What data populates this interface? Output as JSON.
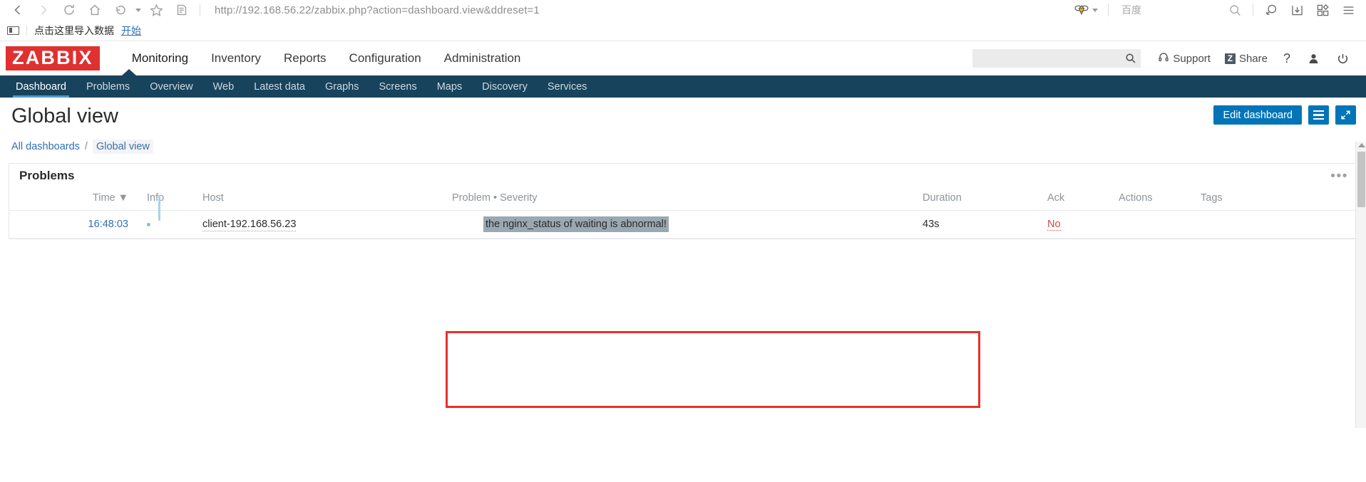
{
  "browser": {
    "url": "http://192.168.56.22/zabbix.php?action=dashboard.view&ddreset=1",
    "search_engine": "百度",
    "search_placeholder": "",
    "nav_icons": [
      "back-icon",
      "forward-icon",
      "reload-icon",
      "home-icon",
      "history-back-icon",
      "bookmark-star-icon",
      "reading-list-icon"
    ],
    "right_icons": [
      "bee-icon",
      "caret-down-icon",
      "search-icon",
      "lens-search-icon",
      "download-icon",
      "apps-grid-icon",
      "menu-icon"
    ]
  },
  "bookmarks": {
    "label": "点击这里导入数据",
    "link": "开始"
  },
  "zabbix": {
    "logo": "ZABBIX",
    "main_nav": [
      {
        "label": "Monitoring",
        "active": true
      },
      {
        "label": "Inventory",
        "active": false
      },
      {
        "label": "Reports",
        "active": false
      },
      {
        "label": "Configuration",
        "active": false
      },
      {
        "label": "Administration",
        "active": false
      }
    ],
    "header_right": {
      "search_value": "",
      "support_label": "Support",
      "share_badge": "Z",
      "share_label": "Share",
      "help_label": "?",
      "user_icon": "user-icon",
      "signout_icon": "power-icon"
    },
    "sub_nav": [
      {
        "label": "Dashboard",
        "active": true
      },
      {
        "label": "Problems",
        "active": false
      },
      {
        "label": "Overview",
        "active": false
      },
      {
        "label": "Web",
        "active": false
      },
      {
        "label": "Latest data",
        "active": false
      },
      {
        "label": "Graphs",
        "active": false
      },
      {
        "label": "Screens",
        "active": false
      },
      {
        "label": "Maps",
        "active": false
      },
      {
        "label": "Discovery",
        "active": false
      },
      {
        "label": "Services",
        "active": false
      }
    ],
    "page": {
      "title": "Global view",
      "edit_button": "Edit dashboard",
      "breadcrumb": {
        "all": "All dashboards",
        "sep": "/",
        "current": "Global view"
      }
    },
    "widget": {
      "title": "Problems",
      "menu_dots": "•••",
      "columns": {
        "time": "Time ▼",
        "info": "Info",
        "host": "Host",
        "problem": "Problem • Severity",
        "duration": "Duration",
        "ack": "Ack",
        "actions": "Actions",
        "tags": "Tags"
      },
      "rows": [
        {
          "time": "16:48:03",
          "info": "",
          "host": "client-192.168.56.23",
          "problem": "the nginx_status of waiting is abnormal!",
          "duration": "43s",
          "ack": "No",
          "actions": "",
          "tags": ""
        }
      ]
    }
  },
  "colors": {
    "zabbix_red": "#e03030",
    "nav_dark": "#18435c",
    "primary_blue": "#0275b8",
    "link_blue": "#2f6fb5",
    "annotation_red": "#e8302b",
    "ack_red": "#d64545",
    "selection_grey": "#9aa8b2"
  }
}
